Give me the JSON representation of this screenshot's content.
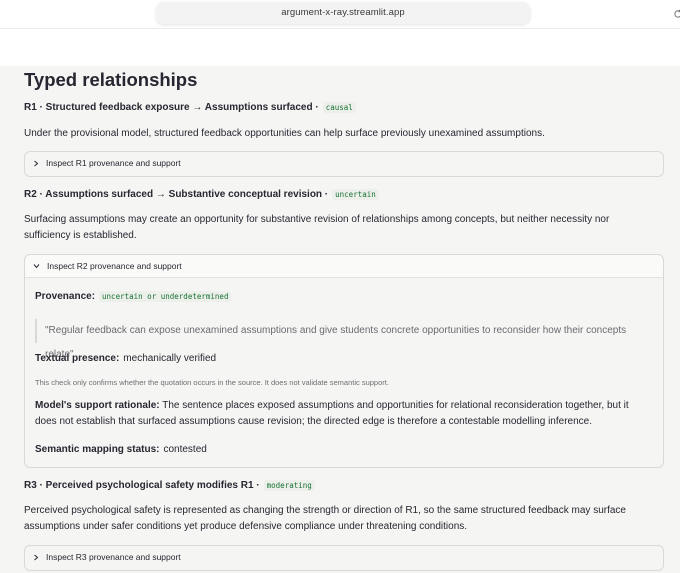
{
  "browser": {
    "url": "argument-x-ray.streamlit.app"
  },
  "page": {
    "heading": "Typed relationships"
  },
  "r1": {
    "title": "R1 · Structured feedback exposure → Assumptions surfaced ·",
    "type": "causal",
    "description": "Under the provisional model, structured feedback opportunities can help surface previously unexamined assumptions.",
    "expander": "Inspect R1 provenance and support"
  },
  "r2": {
    "title": "R2 · Assumptions surfaced → Substantive conceptual revision ·",
    "type": "uncertain",
    "description": "Surfacing assumptions may create an opportunity for substantive revision of relationships among concepts, but neither necessity nor sufficiency is established.",
    "expander": "Inspect R2 provenance and support",
    "provenance_label": "Provenance:",
    "provenance_value": "uncertain or underdetermined",
    "quote": "\"Regular feedback can expose unexamined assumptions and give students concrete opportunities to reconsider how their concepts relate\"",
    "textual_label": "Textual presence:",
    "textual_value": "mechanically verified",
    "check_note": "This check only confirms whether the quotation occurs in the source. It does not validate semantic support.",
    "rationale_label": "Model's support rationale:",
    "rationale_text": "The sentence places exposed assumptions and opportunities for relational reconsideration together, but it does not establish that surfaced assumptions cause revision; the directed edge is therefore a contestable modelling inference.",
    "mapping_label": "Semantic mapping status:",
    "mapping_value": "contested"
  },
  "r3": {
    "title": "R3 · Perceived psychological safety modifies R1 ·",
    "type": "moderating",
    "description": "Perceived psychological safety is represented as changing the strength or direction of R1, so the same structured feedback may surface assumptions under safer conditions yet produce defensive compliance under threatening conditions.",
    "expander": "Inspect R3 provenance and support"
  },
  "icons": {
    "reload": "reload-icon",
    "collapsed": "chevron-right-icon",
    "expanded": "chevron-down-icon"
  },
  "colors": {
    "code_text": "#177233",
    "code_bg": "#ecefea",
    "page_bg": "#f5f5f4"
  }
}
